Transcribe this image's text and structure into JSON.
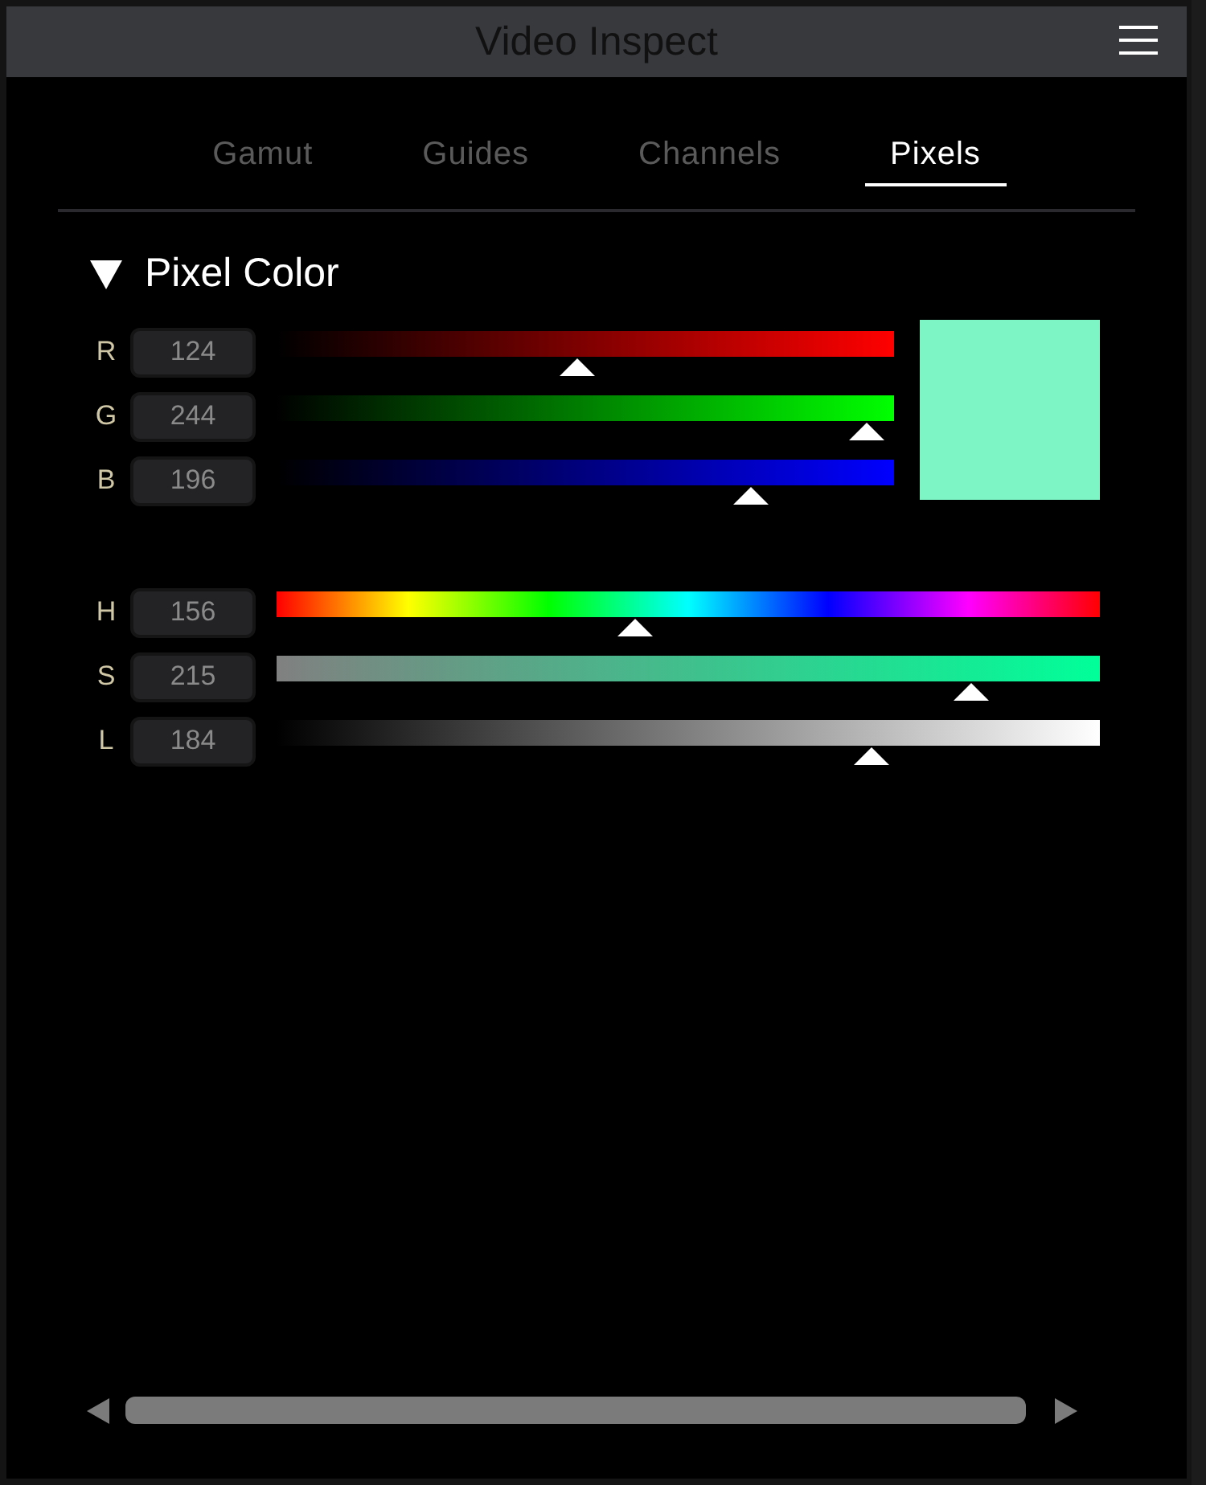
{
  "window": {
    "title": "Video Inspect"
  },
  "tabs": [
    {
      "label": "Gamut",
      "selected": false
    },
    {
      "label": "Guides",
      "selected": false
    },
    {
      "label": "Channels",
      "selected": false
    },
    {
      "label": "Pixels",
      "selected": true
    }
  ],
  "section": {
    "title": "Pixel Color",
    "expanded": true
  },
  "swatch": {
    "color": "#7ef5c4"
  },
  "rgb_channels": [
    {
      "label": "R",
      "value": "124",
      "kind": "red",
      "level": 0.486
    },
    {
      "label": "G",
      "value": "244",
      "kind": "green",
      "level": 0.957
    },
    {
      "label": "B",
      "value": "196",
      "kind": "blue",
      "level": 0.769
    }
  ],
  "hsl_channels": [
    {
      "label": "H",
      "value": "156",
      "kind": "hue",
      "level": 0.435
    },
    {
      "label": "S",
      "value": "215",
      "kind": "saturation",
      "level": 0.843
    },
    {
      "label": "L",
      "value": "184",
      "kind": "lightness",
      "level": 0.722
    }
  ]
}
